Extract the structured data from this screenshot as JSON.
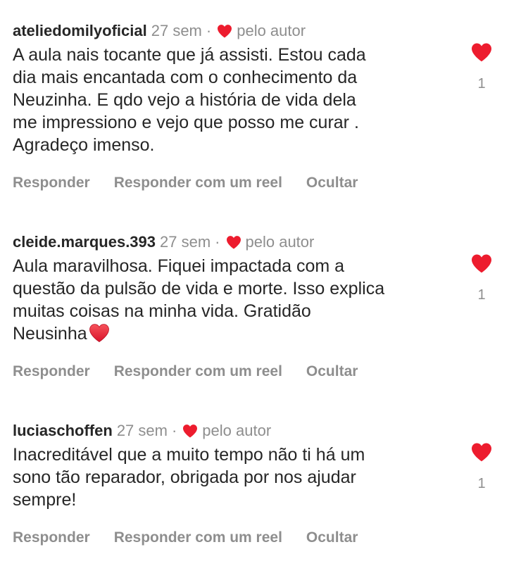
{
  "colors": {
    "heart": "#ed1c2e",
    "text": "#262626",
    "muted": "#8e8e8e"
  },
  "comments": [
    {
      "username": "ateliedomilyoficial",
      "time": "27 sem",
      "separator": "·",
      "author_label": "pelo autor",
      "text": "A aula nais tocante que já assisti.  Estou cada\ndia mais  encantada com o conhecimento  da\nNeuzinha. E qdo vejo a história  de vida dela\nme impressiono e vejo que posso me curar .\nAgradeço  imenso.",
      "actions": {
        "reply": "Responder",
        "reply_reel": "Responder com um reel",
        "hide": "Ocultar"
      },
      "likes": "1",
      "like_icon": "heart-filled-icon"
    },
    {
      "username": "cleide.marques.393",
      "time": "27 sem",
      "separator": "·",
      "author_label": "pelo autor",
      "text": "Aula maravilhosa. Fiquei impactada com a\nquestão da pulsão de vida e morte. Isso explica\nmuitas coisas na minha vida. Gratidão\nNeusinha",
      "emoji": "red-heart-emoji",
      "actions": {
        "reply": "Responder",
        "reply_reel": "Responder com um reel",
        "hide": "Ocultar"
      },
      "likes": "1",
      "like_icon": "heart-filled-icon"
    },
    {
      "username": "luciaschoffen",
      "time": "27 sem",
      "separator": "·",
      "author_label": "pelo autor",
      "text": "Inacreditável que a muito tempo não  ti há um\nsono tão reparador, obrigada por nos ajudar\nsempre!",
      "actions": {
        "reply": "Responder",
        "reply_reel": "Responder com um reel",
        "hide": "Ocultar"
      },
      "likes": "1",
      "like_icon": "heart-filled-icon"
    }
  ]
}
